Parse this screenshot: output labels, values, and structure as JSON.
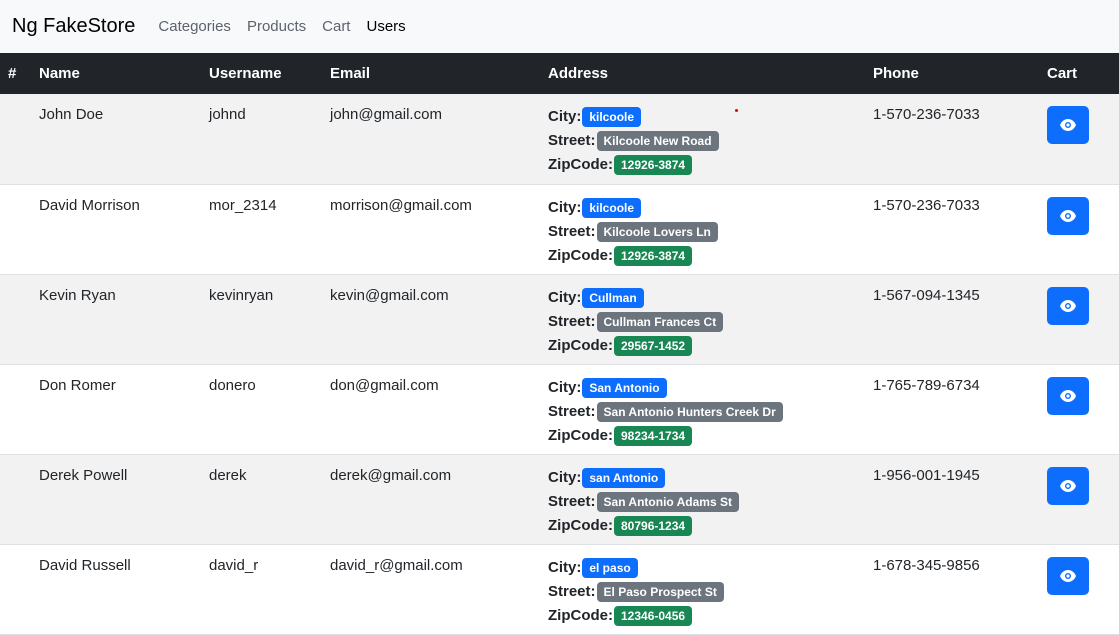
{
  "navbar": {
    "brand": "Ng FakeStore",
    "links": [
      "Categories",
      "Products",
      "Cart",
      "Users"
    ]
  },
  "table": {
    "headers": [
      "#",
      "Name",
      "Username",
      "Email",
      "Address",
      "Phone",
      "Cart"
    ],
    "address_labels": {
      "city": "City:",
      "street": "Street:",
      "zipcode": "ZipCode:"
    },
    "rows": [
      {
        "name": "John Doe",
        "username": "johnd",
        "email": "john@gmail.com",
        "city": "kilcoole",
        "street": "Kilcoole New Road",
        "zipcode": "12926-3874",
        "phone": "1-570-236-7033"
      },
      {
        "name": "David Morrison",
        "username": "mor_2314",
        "email": "morrison@gmail.com",
        "city": "kilcoole",
        "street": "Kilcoole Lovers Ln",
        "zipcode": "12926-3874",
        "phone": "1-570-236-7033"
      },
      {
        "name": "Kevin Ryan",
        "username": "kevinryan",
        "email": "kevin@gmail.com",
        "city": "Cullman",
        "street": "Cullman Frances Ct",
        "zipcode": "29567-1452",
        "phone": "1-567-094-1345"
      },
      {
        "name": "Don Romer",
        "username": "donero",
        "email": "don@gmail.com",
        "city": "San Antonio",
        "street": "San Antonio Hunters Creek Dr",
        "zipcode": "98234-1734",
        "phone": "1-765-789-6734"
      },
      {
        "name": "Derek Powell",
        "username": "derek",
        "email": "derek@gmail.com",
        "city": "san Antonio",
        "street": "San Antonio Adams St",
        "zipcode": "80796-1234",
        "phone": "1-956-001-1945"
      },
      {
        "name": "David Russell",
        "username": "david_r",
        "email": "david_r@gmail.com",
        "city": "el paso",
        "street": "El Paso Prospect St",
        "zipcode": "12346-0456",
        "phone": "1-678-345-9856"
      }
    ]
  },
  "colors": {
    "city_badge": "#0d6efd",
    "street_badge": "#6c757d",
    "zip_badge": "#198754",
    "header_bg": "#212529",
    "button": "#0d6efd"
  }
}
